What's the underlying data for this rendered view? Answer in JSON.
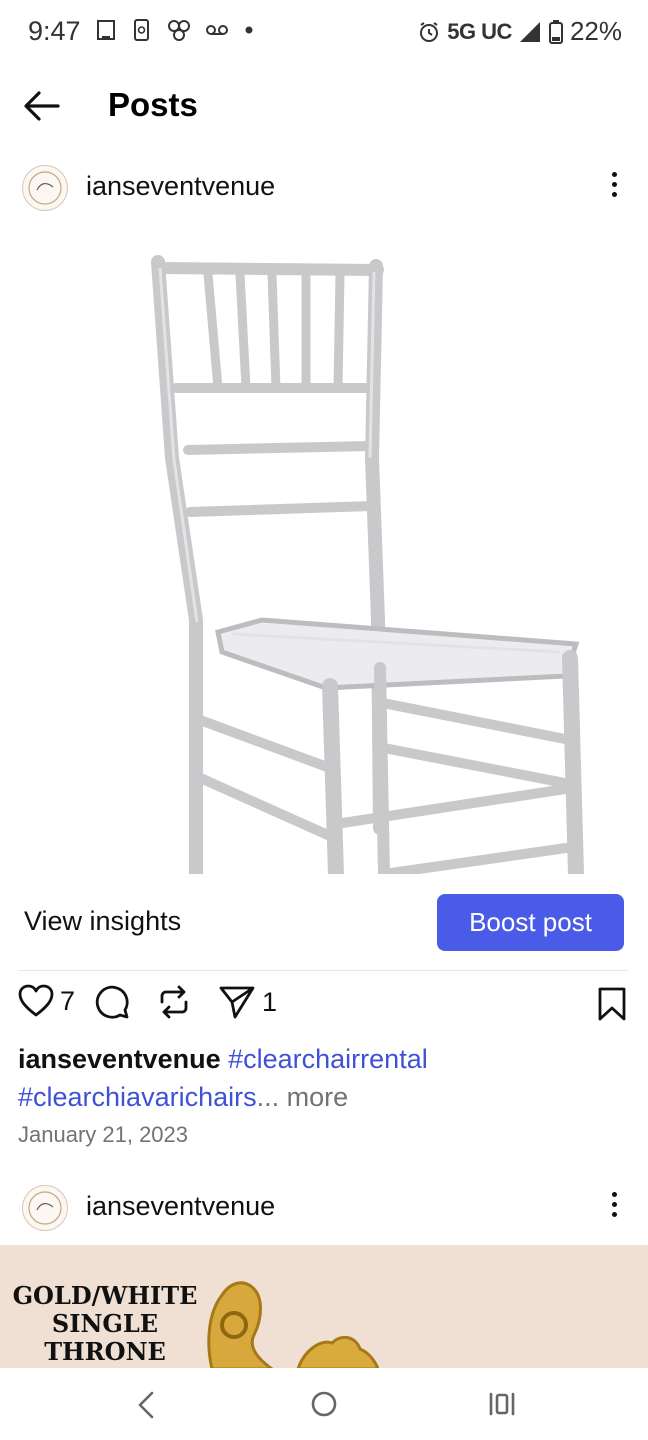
{
  "status_bar": {
    "time": "9:47",
    "network": "5G UC",
    "battery": "22%"
  },
  "header": {
    "title": "Posts"
  },
  "post1": {
    "username": "ianseventvenue",
    "image_description": "clear acrylic chiavari chair",
    "view_insights": "View insights",
    "boost_label": "Boost post",
    "likes": "7",
    "shares": "1",
    "caption_user": "ianseventvenue",
    "tag1": "#clearchairrental",
    "tag2": "#clearchiavarichairs",
    "ellipsis_more": "... more",
    "date": "January 21, 2023"
  },
  "post2": {
    "username": "ianseventvenue",
    "image_text_lines": [
      "GOLD/WHITE",
      "SINGLE",
      "THRONE"
    ]
  },
  "colors": {
    "accent": "#4a5ce7",
    "hashtag": "#3f51d6",
    "muted": "#737373",
    "banner_bg": "#efe0d3"
  }
}
